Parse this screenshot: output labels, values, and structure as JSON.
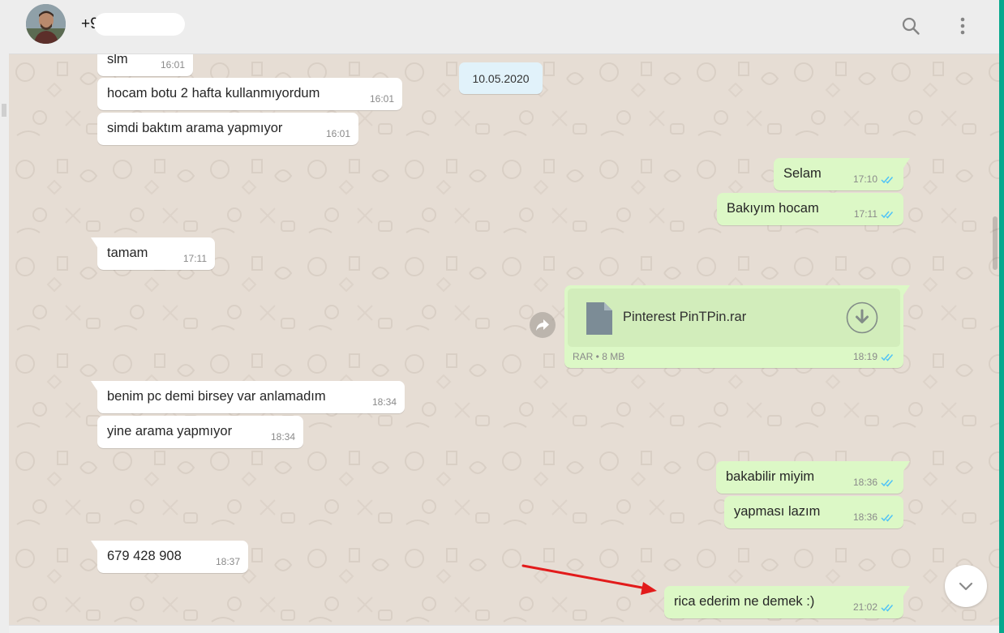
{
  "header": {
    "contact_name": "+9 34 40",
    "search_icon": "search-icon",
    "menu_icon": "menu-kebab-icon"
  },
  "colors": {
    "incoming_bubble": "#ffffff",
    "outgoing_bubble": "#dcf8c6",
    "chat_background": "#e6ddd4",
    "read_ticks": "#4fc3f7",
    "accent": "#06a88d",
    "annotation_arrow": "#e21b1b"
  },
  "date_separator": "10.05.2020",
  "messages": [
    {
      "dir": "in",
      "text": "slm",
      "time": "16:01"
    },
    {
      "dir": "in",
      "text": "hocam botu 2 hafta kullanmıyordum",
      "time": "16:01"
    },
    {
      "dir": "in",
      "text": "simdi baktım arama yapmıyor",
      "time": "16:01"
    },
    {
      "dir": "out",
      "text": "Selam",
      "time": "17:10"
    },
    {
      "dir": "out",
      "text": "Bakıyım hocam",
      "time": "17:11"
    },
    {
      "dir": "in",
      "text": "tamam",
      "time": "17:11"
    },
    {
      "dir": "in",
      "text": "benim pc demi birsey var anlamadım",
      "time": "18:34"
    },
    {
      "dir": "in",
      "text": "yine arama yapmıyor",
      "time": "18:34"
    },
    {
      "dir": "out",
      "text": "bakabilir miyim",
      "time": "18:36"
    },
    {
      "dir": "out",
      "text": "yapması lazım",
      "time": "18:36"
    },
    {
      "dir": "in",
      "text": "679 428 908",
      "time": "18:37"
    },
    {
      "dir": "out",
      "text": "rica ederim ne demek :)",
      "time": "21:02"
    }
  ],
  "file_message": {
    "file_name": "Pinterest PinTPin.rar",
    "meta": "RAR • 8 MB",
    "time": "18:19",
    "icon": "document-icon",
    "download_icon": "download-icon"
  },
  "controls": {
    "forward_icon": "forward-icon",
    "scroll_down_icon": "chevron-down-icon"
  }
}
